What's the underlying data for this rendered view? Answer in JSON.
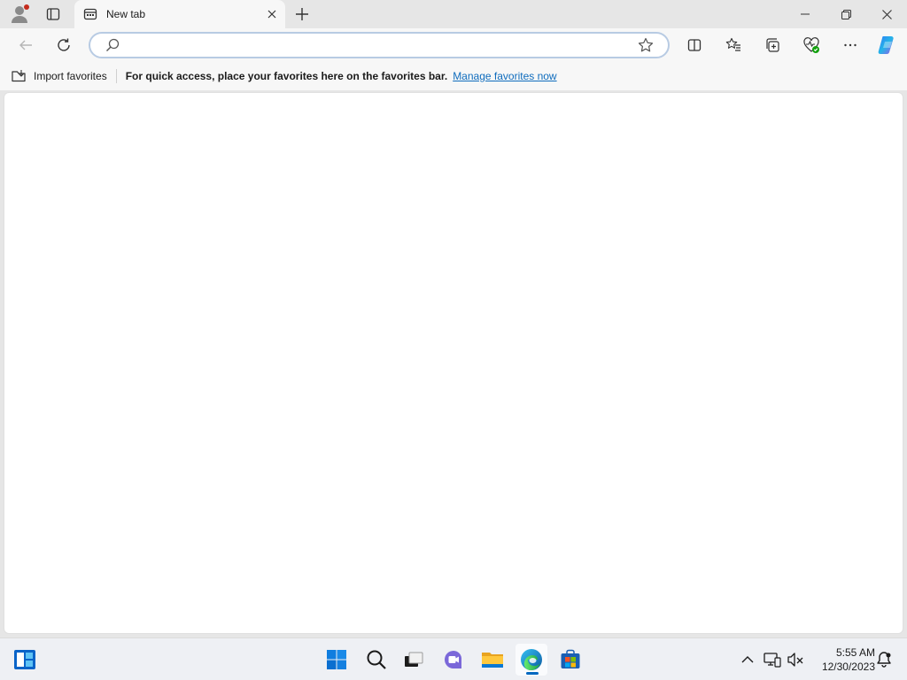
{
  "browser": {
    "tab": {
      "title": "New tab"
    },
    "address_bar": {
      "value": "",
      "placeholder": ""
    },
    "favorites_bar": {
      "import_label": "Import favorites",
      "message": "For quick access, place your favorites here on the favorites bar.",
      "manage_link": "Manage favorites now"
    },
    "accent_color": "#0f6cbd",
    "icons": [
      "profile-icon",
      "tab-actions-icon",
      "new-tab-page-icon",
      "close-icon",
      "plus-icon",
      "minimize-icon",
      "restore-icon",
      "back-arrow-icon",
      "refresh-icon",
      "search-icon",
      "star-icon",
      "split-screen-icon",
      "favorites-icon",
      "collections-icon",
      "browser-essentials-icon",
      "more-icon",
      "copilot-icon",
      "import-favorites-icon"
    ]
  },
  "taskbar": {
    "clock": {
      "time": "5:55 AM",
      "date": "12/30/2023"
    },
    "apps": [
      "widgets",
      "start",
      "search",
      "task-view",
      "chat",
      "file-explorer",
      "edge",
      "store"
    ],
    "active_app": "edge"
  }
}
